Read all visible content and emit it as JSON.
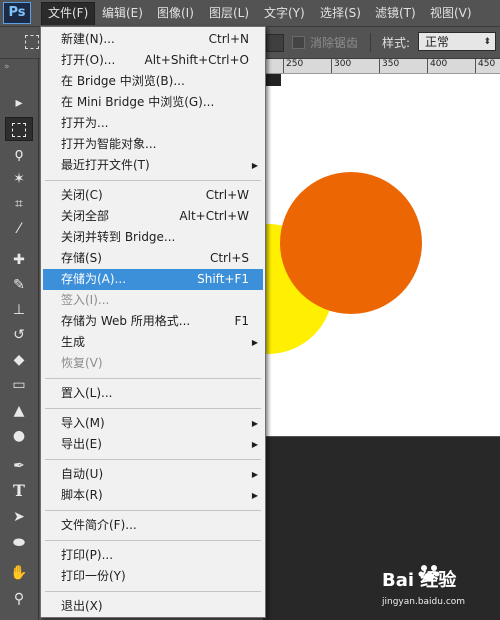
{
  "app": {
    "logo": "Ps"
  },
  "menubar": {
    "items": [
      {
        "label": "文件(F)"
      },
      {
        "label": "编辑(E)"
      },
      {
        "label": "图像(I)"
      },
      {
        "label": "图层(L)"
      },
      {
        "label": "文字(Y)"
      },
      {
        "label": "选择(S)"
      },
      {
        "label": "滤镜(T)"
      },
      {
        "label": "视图(V)"
      }
    ]
  },
  "options": {
    "antialias_label": "消除锯齿",
    "style_label": "样式:",
    "style_value": "正常"
  },
  "ruler": {
    "ticks": [
      "250",
      "300",
      "350",
      "400",
      "450"
    ]
  },
  "file_menu": {
    "groups": [
      [
        {
          "label": "新建(N)...",
          "shortcut": "Ctrl+N"
        },
        {
          "label": "打开(O)...",
          "shortcut": "Alt+Shift+Ctrl+O"
        },
        {
          "label": "在 Bridge 中浏览(B)...",
          "shortcut": ""
        },
        {
          "label": "在 Mini Bridge 中浏览(G)...",
          "shortcut": ""
        },
        {
          "label": "打开为...",
          "shortcut": ""
        },
        {
          "label": "打开为智能对象...",
          "shortcut": ""
        },
        {
          "label": "最近打开文件(T)",
          "shortcut": "",
          "submenu": true
        }
      ],
      [
        {
          "label": "关闭(C)",
          "shortcut": "Ctrl+W"
        },
        {
          "label": "关闭全部",
          "shortcut": "Alt+Ctrl+W"
        },
        {
          "label": "关闭并转到 Bridge...",
          "shortcut": ""
        },
        {
          "label": "存储(S)",
          "shortcut": "Ctrl+S"
        },
        {
          "label": "存储为(A)...",
          "shortcut": "Shift+F1",
          "highlight": true
        },
        {
          "label": "签入(I)...",
          "shortcut": "",
          "disabled": true
        },
        {
          "label": "存储为 Web 所用格式...",
          "shortcut": "F1"
        },
        {
          "label": "生成",
          "shortcut": "",
          "submenu": true
        },
        {
          "label": "恢复(V)",
          "shortcut": "",
          "disabled": true
        }
      ],
      [
        {
          "label": "置入(L)...",
          "shortcut": ""
        }
      ],
      [
        {
          "label": "导入(M)",
          "shortcut": "",
          "submenu": true
        },
        {
          "label": "导出(E)",
          "shortcut": "",
          "submenu": true
        }
      ],
      [
        {
          "label": "自动(U)",
          "shortcut": "",
          "submenu": true
        },
        {
          "label": "脚本(R)",
          "shortcut": "",
          "submenu": true
        }
      ],
      [
        {
          "label": "文件简介(F)...",
          "shortcut": ""
        }
      ],
      [
        {
          "label": "打印(P)...",
          "shortcut": ""
        },
        {
          "label": "打印一份(Y)",
          "shortcut": ""
        }
      ],
      [
        {
          "label": "退出(X)",
          "shortcut": ""
        }
      ]
    ]
  },
  "toolbox": {
    "tools": [
      {
        "name": "move-tool-icon",
        "glyph": "▸"
      },
      {
        "name": "marquee-tool-icon",
        "glyph": "",
        "selected": true
      },
      {
        "name": "lasso-tool-icon",
        "glyph": "ϙ"
      },
      {
        "name": "magic-wand-tool-icon",
        "glyph": "✶"
      },
      {
        "name": "crop-tool-icon",
        "glyph": "⌗"
      },
      {
        "name": "eyedropper-tool-icon",
        "glyph": "⁄"
      },
      {
        "name": "healing-brush-tool-icon",
        "glyph": "✚"
      },
      {
        "name": "brush-tool-icon",
        "glyph": "✎"
      },
      {
        "name": "clone-stamp-tool-icon",
        "glyph": "⊥"
      },
      {
        "name": "history-brush-tool-icon",
        "glyph": "↺"
      },
      {
        "name": "eraser-tool-icon",
        "glyph": "◆"
      },
      {
        "name": "gradient-tool-icon",
        "glyph": "▭"
      },
      {
        "name": "blur-tool-icon",
        "glyph": "▲"
      },
      {
        "name": "dodge-tool-icon",
        "glyph": "●"
      },
      {
        "name": "pen-tool-icon",
        "glyph": "✒"
      },
      {
        "name": "type-tool-icon",
        "glyph": "T"
      },
      {
        "name": "path-selection-tool-icon",
        "glyph": "➤"
      },
      {
        "name": "ellipse-tool-icon",
        "glyph": "⬬"
      },
      {
        "name": "hand-tool-icon",
        "glyph": "✋"
      },
      {
        "name": "zoom-tool-icon",
        "glyph": "⚲"
      }
    ]
  },
  "canvas": {
    "colors": {
      "yellow": "#ffef00",
      "orange": "#ec6704"
    }
  },
  "watermark": {
    "logo": "Bai 经验",
    "url": "jingyan.baidu.com"
  },
  "colors": {
    "menu_highlight": "#3c8fd9",
    "chrome": "#535353"
  }
}
